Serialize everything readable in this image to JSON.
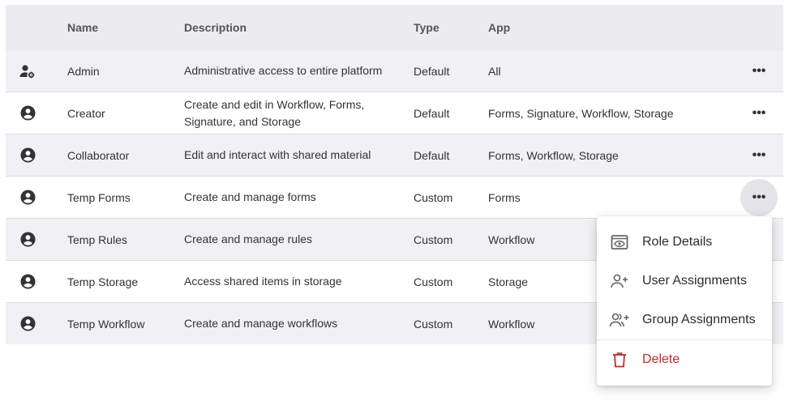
{
  "table": {
    "headers": {
      "name": "Name",
      "description": "Description",
      "type": "Type",
      "app": "App"
    },
    "rows": [
      {
        "icon": "admin-user-gear-icon",
        "name": "Admin",
        "description": "Administrative access to entire platform",
        "type": "Default",
        "app": "All"
      },
      {
        "icon": "account-circle-icon",
        "name": "Creator",
        "description": "Create and edit in Workflow, Forms, Signature, and Storage",
        "type": "Default",
        "app": "Forms, Signature, Workflow, Storage"
      },
      {
        "icon": "account-circle-icon",
        "name": "Collaborator",
        "description": "Edit and interact with shared material",
        "type": "Default",
        "app": "Forms, Workflow, Storage"
      },
      {
        "icon": "account-circle-icon",
        "name": "Temp Forms",
        "description": "Create and manage forms",
        "type": "Custom",
        "app": "Forms"
      },
      {
        "icon": "account-circle-icon",
        "name": "Temp Rules",
        "description": "Create and manage rules",
        "type": "Custom",
        "app": "Workflow"
      },
      {
        "icon": "account-circle-icon",
        "name": "Temp Storage",
        "description": "Access shared items in storage",
        "type": "Custom",
        "app": "Storage"
      },
      {
        "icon": "account-circle-icon",
        "name": "Temp Workflow",
        "description": "Create and manage workflows",
        "type": "Custom",
        "app": "Workflow"
      }
    ],
    "more_glyph": "•••"
  },
  "menu": {
    "items": [
      {
        "label": "Role Details",
        "icon": "eye-card-icon"
      },
      {
        "label": "User Assignments",
        "icon": "user-add-icon"
      },
      {
        "label": "Group Assignments",
        "icon": "group-add-icon"
      },
      {
        "label": "Delete",
        "icon": "trash-icon"
      }
    ]
  },
  "colors": {
    "header_bg": "#ecebef",
    "shaded_row": "#f1f0f4",
    "danger": "#c62828"
  }
}
